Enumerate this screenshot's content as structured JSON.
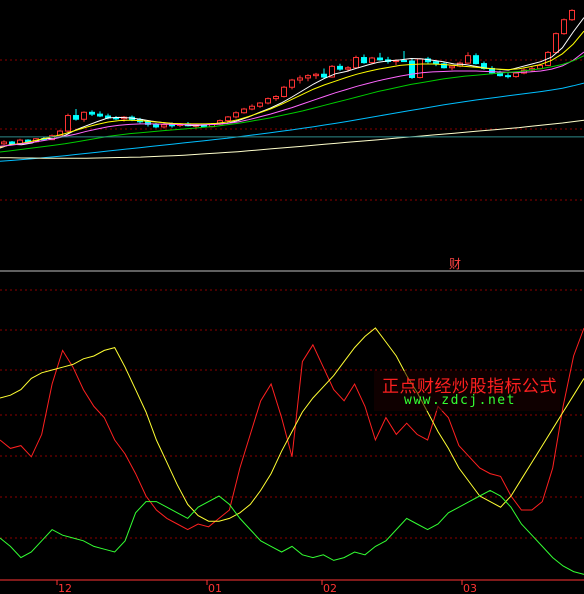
{
  "colors": {
    "background": "#000000",
    "grid": "#8b0000",
    "up": "#ff3333",
    "down": "#00ffff",
    "ma_white": "#ffffff",
    "ma_yellow": "#ffff00",
    "ma_magenta": "#ff66ff",
    "ma_green": "#00cc00",
    "ma_cyan": "#00bfff",
    "ma_long": "#ffffcc",
    "ma_teal": "#2e8b8b",
    "ind_red": "#ff2020",
    "ind_yellow": "#ffff33",
    "ind_green": "#33ff33",
    "axis_label": "#ff3333"
  },
  "top_panel": {
    "event_marker_label": "财"
  },
  "bottom_panel": {
    "x_ticks": [
      "12",
      "01",
      "02",
      "03"
    ]
  },
  "watermark": {
    "title": "正点财经炒股指标公式",
    "url": "www.zdcj.net"
  },
  "chart_data": [
    {
      "type": "candlestick",
      "title": "",
      "price_range": [
        0,
        100
      ],
      "price_range_note": "",
      "candles": [
        [
          38,
          39.5,
          37.5,
          38.8
        ],
        [
          38.8,
          39.2,
          37.8,
          38.1
        ],
        [
          38.1,
          40.2,
          37.9,
          39.6
        ],
        [
          39.6,
          40,
          38.5,
          38.9
        ],
        [
          38.9,
          40.5,
          38.6,
          40.2
        ],
        [
          40.2,
          41,
          39.4,
          39.8
        ],
        [
          39.8,
          42,
          39.6,
          41.5
        ],
        [
          41.5,
          44,
          41,
          43.5
        ],
        [
          43.5,
          51,
          43,
          50.2
        ],
        [
          50.2,
          53,
          48,
          48.6
        ],
        [
          48.6,
          52,
          47.5,
          51.6
        ],
        [
          51.6,
          52.4,
          50,
          50.8
        ],
        [
          50.8,
          52,
          49.5,
          50
        ],
        [
          50,
          51,
          48.6,
          49.2
        ],
        [
          49.2,
          50,
          48.2,
          48.8
        ],
        [
          48.8,
          50,
          47.6,
          49.5
        ],
        [
          49.5,
          50.2,
          47.8,
          48.5
        ],
        [
          48.5,
          49.2,
          46.8,
          47.5
        ],
        [
          47.5,
          48,
          45.5,
          46.4
        ],
        [
          46.4,
          47,
          44.8,
          45.3
        ],
        [
          45.3,
          46.8,
          44.6,
          46.2
        ],
        [
          46.2,
          47.2,
          45,
          45.9
        ],
        [
          45.9,
          47,
          45.2,
          46.6
        ],
        [
          46.6,
          47.4,
          45.5,
          45.8
        ],
        [
          45.8,
          46.5,
          44.9,
          46
        ],
        [
          46,
          46.6,
          45,
          45.4
        ],
        [
          45.4,
          47,
          45.1,
          46.5
        ],
        [
          46.5,
          48.5,
          46,
          48
        ],
        [
          48,
          50,
          47.5,
          49.6
        ],
        [
          49.6,
          52,
          49,
          51.4
        ],
        [
          51.4,
          53.5,
          51,
          53
        ],
        [
          53,
          55,
          52.5,
          54.2
        ],
        [
          54.2,
          56,
          53.5,
          55.6
        ],
        [
          55.6,
          58,
          55,
          57.5
        ],
        [
          57.5,
          59,
          56.5,
          58.4
        ],
        [
          58.4,
          63,
          58,
          62.4
        ],
        [
          62.4,
          66,
          61.5,
          65.5
        ],
        [
          65.5,
          67.5,
          64,
          66.4
        ],
        [
          66.4,
          68,
          65,
          67.4
        ],
        [
          67.4,
          68.6,
          66,
          68
        ],
        [
          68,
          70.5,
          66.2,
          66.8
        ],
        [
          66.8,
          72,
          66.5,
          71.4
        ],
        [
          71.4,
          72.5,
          69.5,
          70.2
        ],
        [
          70.2,
          71.5,
          69,
          70.8
        ],
        [
          70.8,
          76,
          70.5,
          75.2
        ],
        [
          75.2,
          76.5,
          72.5,
          73
        ],
        [
          73,
          75.5,
          72.5,
          75
        ],
        [
          75,
          77.2,
          73.8,
          74.2
        ],
        [
          74.2,
          75.5,
          72.6,
          73.5
        ],
        [
          73.5,
          74.4,
          72,
          73.9
        ],
        [
          73.9,
          78,
          73.5,
          73.7
        ],
        [
          73.7,
          75,
          66,
          66.6
        ],
        [
          66.6,
          75,
          66.2,
          74.6
        ],
        [
          74.6,
          75.5,
          72.4,
          73.4
        ],
        [
          73.4,
          74,
          71.5,
          72.5
        ],
        [
          72.5,
          73.5,
          70.5,
          70.8
        ],
        [
          70.8,
          72,
          69.8,
          71.5
        ],
        [
          71.5,
          73.5,
          71,
          72.8
        ],
        [
          72.8,
          77.5,
          72.5,
          76
        ],
        [
          76,
          77,
          72.2,
          72.6
        ],
        [
          72.6,
          73.5,
          70,
          70.5
        ],
        [
          70.5,
          71.5,
          68,
          68.6
        ],
        [
          68.6,
          69.5,
          67,
          67.4
        ],
        [
          67.4,
          68.5,
          66.2,
          67
        ],
        [
          67,
          69,
          66.5,
          68.5
        ],
        [
          68.5,
          70.5,
          68,
          69.8
        ],
        [
          69.8,
          71.5,
          69,
          70.4
        ],
        [
          70.4,
          72.5,
          70,
          71.8
        ],
        [
          71.8,
          78,
          71.5,
          77.4
        ],
        [
          77.4,
          86,
          77,
          85.5
        ],
        [
          85.5,
          92,
          85,
          91.5
        ],
        [
          91.5,
          96,
          91,
          95.5
        ]
      ],
      "moving_averages": [
        {
          "name": "",
          "color": "#ffffff",
          "values": [
            36.2,
            37.8,
            37.6,
            38.4,
            40.4,
            40.2,
            41.6,
            44,
            45.8,
            47.6,
            49.2,
            49.4,
            49.2,
            48.6,
            47.8,
            47.2,
            46.6,
            46.2,
            45.8,
            46.2,
            46.6,
            46.8,
            48,
            49.6,
            51.6,
            53.4,
            55.6,
            58.2,
            61,
            63.8,
            66.2,
            68.2,
            69.2,
            70.6,
            72,
            73.2,
            73.8,
            74.2,
            74.8,
            74.6,
            74,
            73.4,
            72.4,
            72.2,
            71.4,
            70.6,
            70.2,
            69.8,
            71,
            72.2,
            73.4,
            75.4,
            79.4,
            86.2,
            92.4
          ]
        },
        {
          "name": "",
          "color": "#ffff00",
          "values": [
            36.6,
            37.6,
            38.2,
            39.2,
            40.2,
            41.2,
            42.4,
            43.8,
            45.2,
            46.4,
            47.4,
            48,
            48.2,
            48,
            47.6,
            47.2,
            46.8,
            46.6,
            46.6,
            46.6,
            46.8,
            47.4,
            48.4,
            49.8,
            51.4,
            53,
            55,
            57.2,
            59.4,
            61.6,
            63.4,
            65,
            66.6,
            68,
            69.2,
            70.2,
            71,
            71.8,
            72.2,
            72.4,
            72.4,
            72.2,
            71.8,
            71.4,
            71,
            70.6,
            70.2,
            70,
            70.4,
            71.2,
            72.2,
            74,
            76.8,
            81,
            86.6
          ]
        },
        {
          "name": "",
          "color": "#ff66ff",
          "values": [
            37,
            37.4,
            38,
            38.6,
            39.4,
            40.2,
            41.2,
            42.2,
            43.4,
            44.4,
            45.4,
            46,
            46.4,
            46.6,
            46.6,
            46.5,
            46.4,
            46.3,
            46.2,
            46.2,
            46.4,
            46.8,
            47.4,
            48.4,
            49.6,
            50.8,
            52.2,
            53.6,
            55.2,
            56.8,
            58.4,
            60,
            61.4,
            62.8,
            64,
            65.2,
            66.2,
            67.2,
            68,
            68.6,
            69,
            69.2,
            69.4,
            69.4,
            69.4,
            69.2,
            69,
            68.8,
            68.8,
            69,
            69.4,
            70.2,
            71.6,
            74,
            77.6
          ]
        },
        {
          "name": "",
          "color": "#00cc00",
          "values": [
            34.5,
            35,
            35.6,
            36.2,
            36.8,
            37.4,
            38,
            38.8,
            39.6,
            40.4,
            41.2,
            41.8,
            42.4,
            42.8,
            43.2,
            43.6,
            44,
            44.4,
            44.8,
            45.2,
            45.6,
            46.2,
            46.8,
            47.6,
            48.4,
            49.2,
            50.2,
            51.2,
            52.2,
            53.4,
            54.6,
            55.8,
            57,
            58.2,
            59.4,
            60.6,
            61.6,
            62.6,
            63.6,
            64.4,
            65.2,
            66,
            66.6,
            67.2,
            67.6,
            68,
            68.4,
            68.8,
            69.2,
            69.8,
            70.4,
            71.2,
            72.2,
            73.8,
            76
          ]
        },
        {
          "name": "",
          "color": "#00bfff",
          "values": [
            30.5,
            30.8,
            31.2,
            31.6,
            32,
            32.4,
            32.9,
            33.4,
            33.9,
            34.4,
            34.9,
            35.4,
            35.9,
            36.4,
            36.9,
            37.4,
            37.9,
            38.4,
            38.9,
            39.4,
            39.9,
            40.4,
            41,
            41.6,
            42.2,
            42.8,
            43.4,
            44,
            44.7,
            45.4,
            46.1,
            46.8,
            47.6,
            48.4,
            49.2,
            50,
            50.8,
            51.6,
            52.4,
            53.2,
            54,
            54.8,
            55.5,
            56.2,
            56.9,
            57.5,
            58.1,
            58.7,
            59.3,
            59.9,
            60.5,
            61.2,
            62,
            63,
            64.2
          ]
        },
        {
          "name": "",
          "color": "#ffffcc",
          "values": [
            32,
            32,
            31.9,
            31.9,
            31.8,
            31.8,
            31.8,
            31.8,
            31.8,
            31.9,
            32,
            32.1,
            32.2,
            32.3,
            32.5,
            32.7,
            32.9,
            33.1,
            33.4,
            33.7,
            34,
            34.3,
            34.6,
            35,
            35.4,
            35.8,
            36.2,
            36.6,
            37,
            37.4,
            37.8,
            38.2,
            38.6,
            39,
            39.4,
            39.8,
            40.2,
            40.6,
            41,
            41.4,
            41.8,
            42.2,
            42.6,
            43,
            43.4,
            43.8,
            44.2,
            44.6,
            45,
            45.5,
            46,
            46.5,
            47,
            47.6,
            48.2
          ]
        },
        {
          "name": "",
          "color": "#2e8b8b",
          "values": [
            41,
            41,
            41,
            41,
            41,
            41,
            41,
            41,
            41,
            41,
            41,
            41,
            41,
            41,
            41,
            41,
            41,
            41,
            41,
            41,
            41,
            41,
            41,
            41,
            41,
            41,
            41,
            41,
            41,
            41,
            41,
            41,
            41,
            41,
            41,
            41,
            41,
            41,
            41,
            41,
            41,
            41,
            41,
            41,
            41,
            41,
            41,
            41,
            41,
            41,
            41,
            41,
            41,
            41,
            41
          ]
        }
      ]
    },
    {
      "type": "line",
      "title": "",
      "x_ticks": [
        "12",
        "01",
        "02",
        "03"
      ],
      "ylim": [
        0,
        100
      ],
      "ylim_note": "",
      "series": [
        {
          "name": "",
          "color": "#ff2020",
          "values": [
            50,
            47,
            48,
            44,
            52,
            70,
            82,
            76,
            68,
            62,
            58,
            50,
            45,
            38,
            30,
            25,
            22,
            20,
            18,
            20,
            19,
            22,
            25,
            40,
            52,
            64,
            70,
            58,
            44,
            78,
            84,
            76,
            68,
            64,
            70,
            62,
            50,
            58,
            52,
            56,
            52,
            50,
            62,
            58,
            48,
            44,
            40,
            38,
            37,
            30,
            25,
            25,
            28,
            40,
            62,
            80,
            90
          ]
        },
        {
          "name": "",
          "color": "#ffff33",
          "values": [
            65,
            66,
            68,
            72,
            74,
            75,
            76,
            77,
            79,
            80,
            82,
            83,
            76,
            68,
            60,
            50,
            42,
            34,
            27,
            23,
            21,
            21,
            22,
            24,
            27,
            32,
            38,
            46,
            53,
            60,
            65,
            69,
            73,
            78,
            83,
            87,
            90,
            85,
            80,
            73,
            67,
            60,
            53,
            47,
            40,
            35,
            30,
            28,
            26,
            30,
            36,
            42,
            48,
            54,
            60,
            66,
            72
          ]
        },
        {
          "name": "",
          "color": "#33ff33",
          "values": [
            15,
            12,
            8,
            10,
            14,
            18,
            16,
            15,
            14,
            12,
            11,
            10,
            14,
            24,
            28,
            28,
            26,
            24,
            22,
            26,
            28,
            30,
            27,
            22,
            18,
            14,
            12,
            10,
            12,
            9,
            8,
            9,
            7,
            8,
            10,
            9,
            12,
            14,
            18,
            22,
            20,
            18,
            20,
            24,
            26,
            28,
            30,
            32,
            30,
            26,
            20,
            16,
            12,
            8,
            5,
            3,
            2
          ]
        }
      ]
    }
  ]
}
